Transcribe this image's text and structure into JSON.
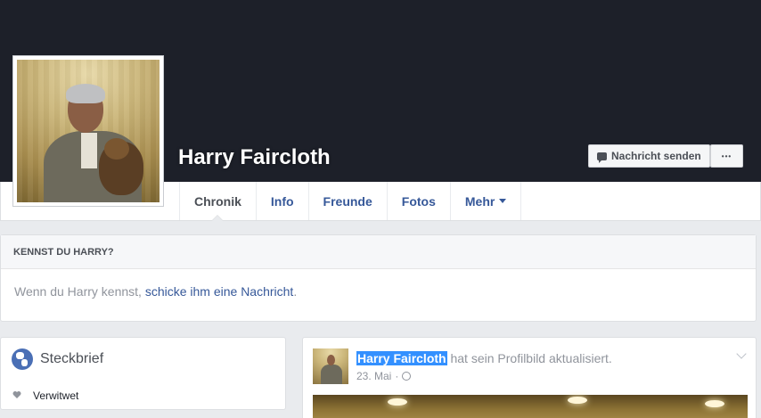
{
  "profile": {
    "name": "Harry Faircloth"
  },
  "actions": {
    "message_label": "Nachricht senden",
    "more_label": "•••"
  },
  "tabs": [
    {
      "label": "Chronik",
      "active": true
    },
    {
      "label": "Info"
    },
    {
      "label": "Freunde"
    },
    {
      "label": "Fotos"
    },
    {
      "label": "Mehr"
    }
  ],
  "know_card": {
    "title": "KENNST DU HARRY?",
    "text_before": "Wenn du Harry kennst, ",
    "link": "schicke ihm eine Nachricht",
    "text_after": "."
  },
  "about": {
    "title": "Steckbrief",
    "items": [
      {
        "icon": "heart-icon",
        "text": "Verwitwet"
      }
    ]
  },
  "post": {
    "author": "Harry Faircloth",
    "action": " hat sein Profilbild aktualisiert.",
    "date": "23. Mai",
    "separator": "·",
    "privacy_icon": "globe-icon"
  },
  "colors": {
    "cover": "#1d2029",
    "link": "#365899",
    "background": "#e9ebee",
    "selection": "#3390ff"
  }
}
